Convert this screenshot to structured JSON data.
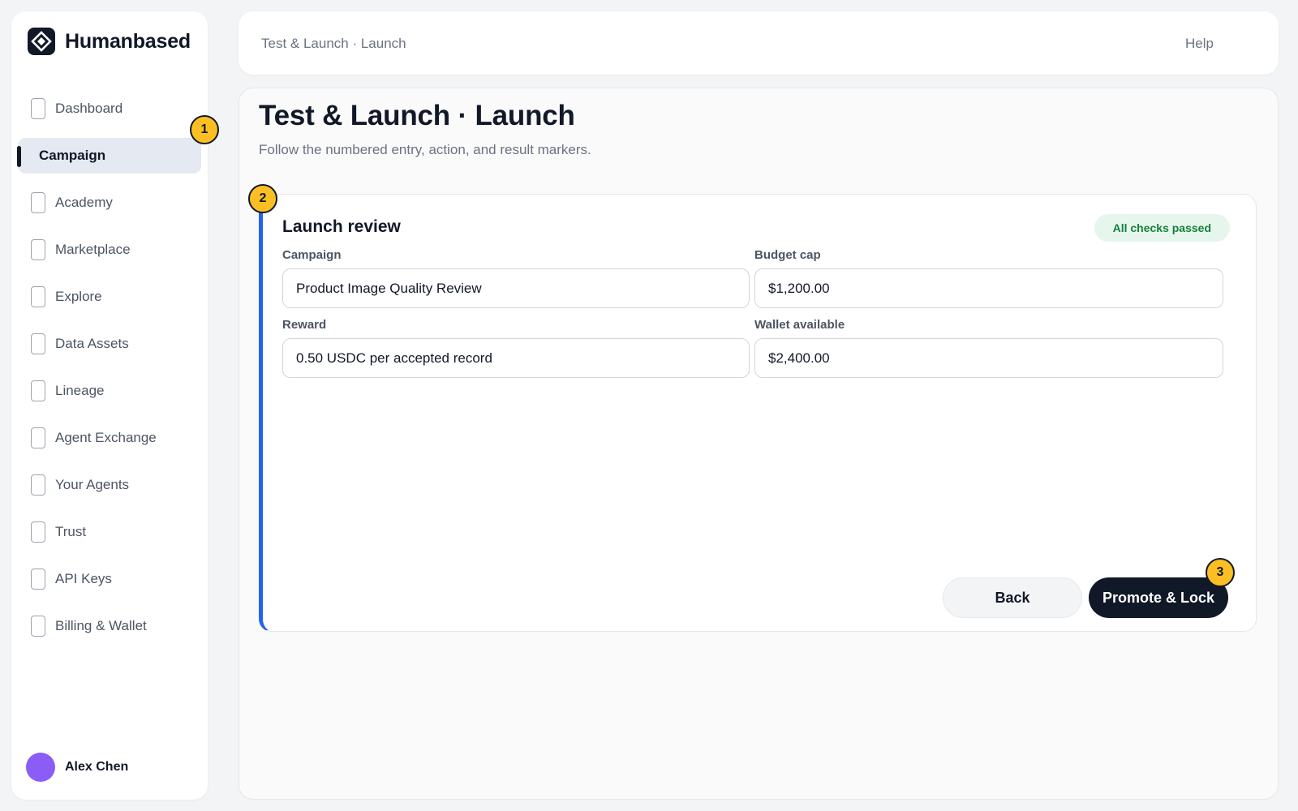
{
  "app": {
    "name": "Humanbased",
    "logo_icon": "diamond-logo-icon"
  },
  "sidebar": {
    "items": [
      {
        "label": "Dashboard",
        "icon": "page-icon",
        "active": false
      },
      {
        "label": "Campaign",
        "icon": "page-icon",
        "active": true
      },
      {
        "label": "Academy",
        "icon": "page-icon",
        "active": false
      },
      {
        "label": "Marketplace",
        "icon": "page-icon",
        "active": false
      },
      {
        "label": "Explore",
        "icon": "page-icon",
        "active": false
      },
      {
        "label": "Data Assets",
        "icon": "page-icon",
        "active": false
      },
      {
        "label": "Lineage",
        "icon": "page-icon",
        "active": false
      },
      {
        "label": "Agent Exchange",
        "icon": "page-icon",
        "active": false
      },
      {
        "label": "Your Agents",
        "icon": "page-icon",
        "active": false
      },
      {
        "label": "Trust",
        "icon": "page-icon",
        "active": false
      },
      {
        "label": "API Keys",
        "icon": "page-icon",
        "active": false
      },
      {
        "label": "Billing & Wallet",
        "icon": "page-icon",
        "active": false
      }
    ],
    "user": {
      "name": "Alex Chen",
      "avatar_color": "#8b5cf6"
    }
  },
  "header": {
    "breadcrumb": "Test & Launch · Launch",
    "help_label": "Help"
  },
  "main": {
    "title": "Test & Launch · Launch",
    "subtitle": "Follow the numbered entry, action, and result markers.",
    "card": {
      "title": "Launch review",
      "status_badge": "All checks passed",
      "fields": {
        "campaign": {
          "label": "Campaign",
          "value": "Product Image Quality Review"
        },
        "budget_cap": {
          "label": "Budget cap",
          "value": "$1,200.00"
        },
        "reward": {
          "label": "Reward",
          "value": "0.50 USDC per accepted record"
        },
        "wallet_available": {
          "label": "Wallet available",
          "value": "$2,400.00"
        }
      },
      "back_label": "Back",
      "primary_label": "Promote & Lock"
    }
  },
  "markers": {
    "m1": "1",
    "m2": "2",
    "m3": "3"
  },
  "colors": {
    "accent": "#2563eb",
    "primary_button": "#111827",
    "marker": "#fbbf24",
    "success_badge_bg": "#e6f6ec",
    "success_badge_text": "#15803d"
  }
}
